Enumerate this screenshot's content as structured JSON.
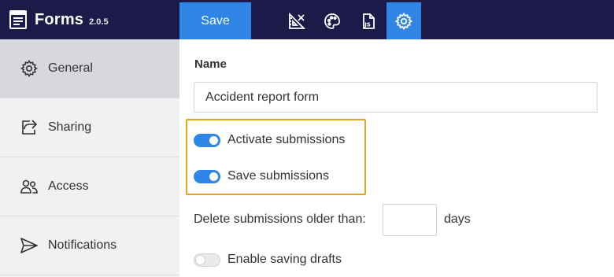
{
  "app": {
    "title": "Forms",
    "version": "2.0.5"
  },
  "toolbar": {
    "save_label": "Save",
    "icons": [
      "ruler-square-icon",
      "palette-icon",
      "js-file-icon",
      "gear-icon"
    ],
    "active_icon": "gear-icon"
  },
  "sidebar": {
    "items": [
      {
        "label": "General",
        "icon": "gear-icon",
        "active": true
      },
      {
        "label": "Sharing",
        "icon": "share-icon",
        "active": false
      },
      {
        "label": "Access",
        "icon": "users-icon",
        "active": false
      },
      {
        "label": "Notifications",
        "icon": "send-icon",
        "active": false
      }
    ]
  },
  "main": {
    "name_label": "Name",
    "name_value": "Accident report form",
    "toggles": [
      {
        "label": "Activate submissions",
        "on": true
      },
      {
        "label": "Save submissions",
        "on": true
      }
    ],
    "delete_label": "Delete submissions older than:",
    "delete_value": "",
    "days_label": "days",
    "drafts_toggle": {
      "label": "Enable saving drafts",
      "on": false
    }
  },
  "colors": {
    "topbar": "#1c1a48",
    "accent": "#2f86e6",
    "highlight": "#e8a420",
    "sidebar_bg": "#f1f1f3",
    "sidebar_active": "#d7d8de"
  }
}
